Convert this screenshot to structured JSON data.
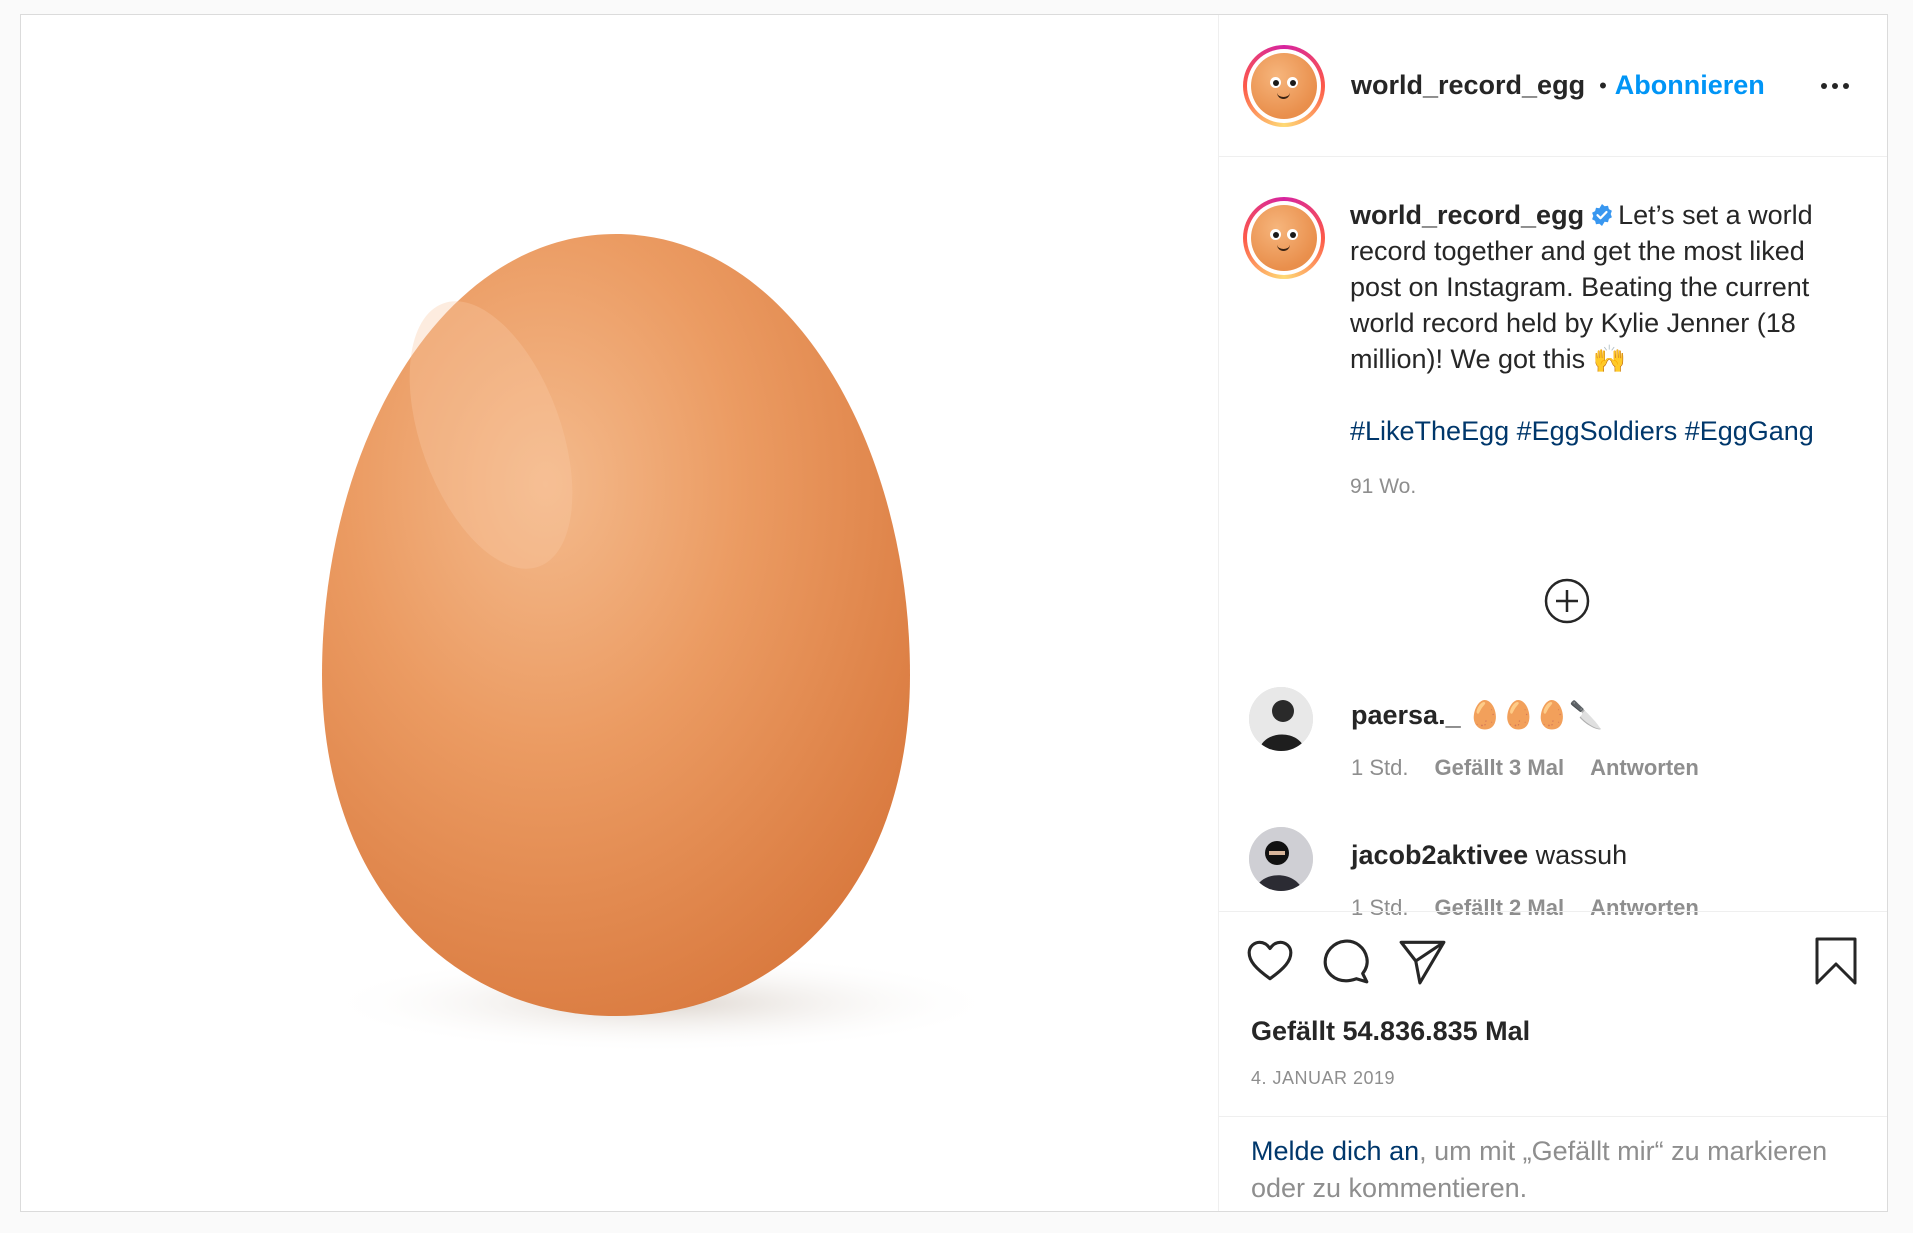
{
  "header": {
    "username": "world_record_egg",
    "separator": "•",
    "follow_label": "Abonnieren"
  },
  "caption": {
    "username": "world_record_egg",
    "text": "Let’s set a world record together and get the most liked post on Instagram. Beating the current world record held by Kylie Jenner (18 million)! We got this 🙌",
    "hashtags": "#LikeTheEgg #EggSoldiers #EggGang",
    "time_ago": "91 Wo."
  },
  "comments": [
    {
      "username": "paersa._",
      "text": "🥚🥚🥚🔪",
      "time": "1 Std.",
      "likes": "Gefällt 3 Mal",
      "reply_label": "Antworten"
    },
    {
      "username": "jacob2aktivee",
      "text": "wassuh",
      "time": "1 Std.",
      "likes": "Gefällt 2 Mal",
      "reply_label": "Antworten"
    }
  ],
  "actions": {
    "likes_text": "Gefällt 54.836.835 Mal",
    "date": "4. JANUAR 2019"
  },
  "login_prompt": {
    "link": "Melde dich an",
    "rest": ", um mit „Gefällt mir“ zu markieren oder zu kommentieren."
  },
  "colors": {
    "accent": "#0095f6",
    "hashtag": "#00376b",
    "muted": "#8e8e8e",
    "egg": "#e8945a"
  }
}
